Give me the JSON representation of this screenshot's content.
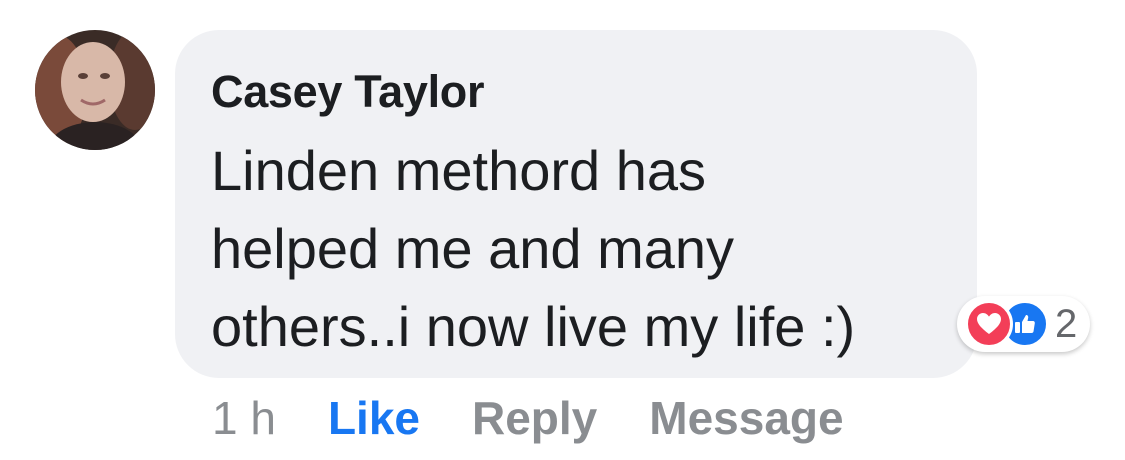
{
  "comment": {
    "author": "Casey Taylor",
    "text": "Linden methord has\nhelped me and many\nothers..i now live my life :)",
    "reactions": {
      "icons": [
        "heart-icon",
        "thumbs-up-icon"
      ],
      "count": "2"
    },
    "timestamp": "1 h",
    "actions": {
      "like": "Like",
      "reply": "Reply",
      "message": "Message"
    }
  },
  "colors": {
    "bubble_bg": "#f0f1f4",
    "like_blue": "#1877f2",
    "love_red": "#f33e58",
    "muted": "#8a8d91"
  }
}
